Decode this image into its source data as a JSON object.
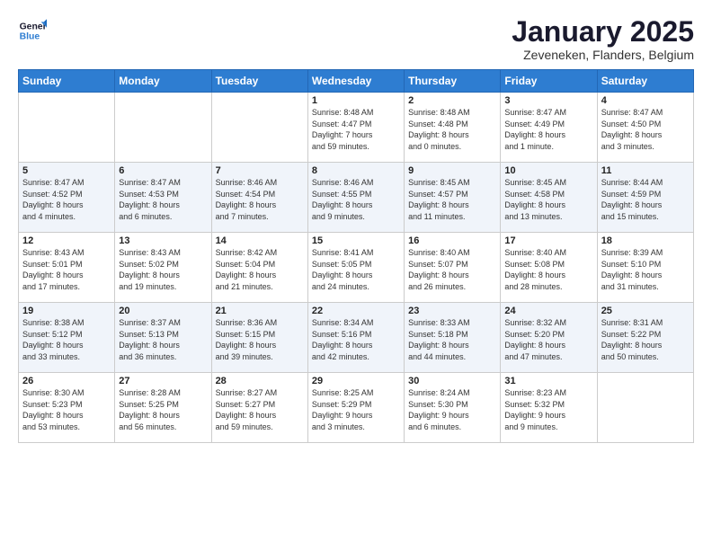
{
  "logo": {
    "line1": "General",
    "line2": "Blue"
  },
  "title": "January 2025",
  "subtitle": "Zeveneken, Flanders, Belgium",
  "days_of_week": [
    "Sunday",
    "Monday",
    "Tuesday",
    "Wednesday",
    "Thursday",
    "Friday",
    "Saturday"
  ],
  "weeks": [
    [
      {
        "day": "",
        "info": ""
      },
      {
        "day": "",
        "info": ""
      },
      {
        "day": "",
        "info": ""
      },
      {
        "day": "1",
        "info": "Sunrise: 8:48 AM\nSunset: 4:47 PM\nDaylight: 7 hours\nand 59 minutes."
      },
      {
        "day": "2",
        "info": "Sunrise: 8:48 AM\nSunset: 4:48 PM\nDaylight: 8 hours\nand 0 minutes."
      },
      {
        "day": "3",
        "info": "Sunrise: 8:47 AM\nSunset: 4:49 PM\nDaylight: 8 hours\nand 1 minute."
      },
      {
        "day": "4",
        "info": "Sunrise: 8:47 AM\nSunset: 4:50 PM\nDaylight: 8 hours\nand 3 minutes."
      }
    ],
    [
      {
        "day": "5",
        "info": "Sunrise: 8:47 AM\nSunset: 4:52 PM\nDaylight: 8 hours\nand 4 minutes."
      },
      {
        "day": "6",
        "info": "Sunrise: 8:47 AM\nSunset: 4:53 PM\nDaylight: 8 hours\nand 6 minutes."
      },
      {
        "day": "7",
        "info": "Sunrise: 8:46 AM\nSunset: 4:54 PM\nDaylight: 8 hours\nand 7 minutes."
      },
      {
        "day": "8",
        "info": "Sunrise: 8:46 AM\nSunset: 4:55 PM\nDaylight: 8 hours\nand 9 minutes."
      },
      {
        "day": "9",
        "info": "Sunrise: 8:45 AM\nSunset: 4:57 PM\nDaylight: 8 hours\nand 11 minutes."
      },
      {
        "day": "10",
        "info": "Sunrise: 8:45 AM\nSunset: 4:58 PM\nDaylight: 8 hours\nand 13 minutes."
      },
      {
        "day": "11",
        "info": "Sunrise: 8:44 AM\nSunset: 4:59 PM\nDaylight: 8 hours\nand 15 minutes."
      }
    ],
    [
      {
        "day": "12",
        "info": "Sunrise: 8:43 AM\nSunset: 5:01 PM\nDaylight: 8 hours\nand 17 minutes."
      },
      {
        "day": "13",
        "info": "Sunrise: 8:43 AM\nSunset: 5:02 PM\nDaylight: 8 hours\nand 19 minutes."
      },
      {
        "day": "14",
        "info": "Sunrise: 8:42 AM\nSunset: 5:04 PM\nDaylight: 8 hours\nand 21 minutes."
      },
      {
        "day": "15",
        "info": "Sunrise: 8:41 AM\nSunset: 5:05 PM\nDaylight: 8 hours\nand 24 minutes."
      },
      {
        "day": "16",
        "info": "Sunrise: 8:40 AM\nSunset: 5:07 PM\nDaylight: 8 hours\nand 26 minutes."
      },
      {
        "day": "17",
        "info": "Sunrise: 8:40 AM\nSunset: 5:08 PM\nDaylight: 8 hours\nand 28 minutes."
      },
      {
        "day": "18",
        "info": "Sunrise: 8:39 AM\nSunset: 5:10 PM\nDaylight: 8 hours\nand 31 minutes."
      }
    ],
    [
      {
        "day": "19",
        "info": "Sunrise: 8:38 AM\nSunset: 5:12 PM\nDaylight: 8 hours\nand 33 minutes."
      },
      {
        "day": "20",
        "info": "Sunrise: 8:37 AM\nSunset: 5:13 PM\nDaylight: 8 hours\nand 36 minutes."
      },
      {
        "day": "21",
        "info": "Sunrise: 8:36 AM\nSunset: 5:15 PM\nDaylight: 8 hours\nand 39 minutes."
      },
      {
        "day": "22",
        "info": "Sunrise: 8:34 AM\nSunset: 5:16 PM\nDaylight: 8 hours\nand 42 minutes."
      },
      {
        "day": "23",
        "info": "Sunrise: 8:33 AM\nSunset: 5:18 PM\nDaylight: 8 hours\nand 44 minutes."
      },
      {
        "day": "24",
        "info": "Sunrise: 8:32 AM\nSunset: 5:20 PM\nDaylight: 8 hours\nand 47 minutes."
      },
      {
        "day": "25",
        "info": "Sunrise: 8:31 AM\nSunset: 5:22 PM\nDaylight: 8 hours\nand 50 minutes."
      }
    ],
    [
      {
        "day": "26",
        "info": "Sunrise: 8:30 AM\nSunset: 5:23 PM\nDaylight: 8 hours\nand 53 minutes."
      },
      {
        "day": "27",
        "info": "Sunrise: 8:28 AM\nSunset: 5:25 PM\nDaylight: 8 hours\nand 56 minutes."
      },
      {
        "day": "28",
        "info": "Sunrise: 8:27 AM\nSunset: 5:27 PM\nDaylight: 8 hours\nand 59 minutes."
      },
      {
        "day": "29",
        "info": "Sunrise: 8:25 AM\nSunset: 5:29 PM\nDaylight: 9 hours\nand 3 minutes."
      },
      {
        "day": "30",
        "info": "Sunrise: 8:24 AM\nSunset: 5:30 PM\nDaylight: 9 hours\nand 6 minutes."
      },
      {
        "day": "31",
        "info": "Sunrise: 8:23 AM\nSunset: 5:32 PM\nDaylight: 9 hours\nand 9 minutes."
      },
      {
        "day": "",
        "info": ""
      }
    ]
  ]
}
